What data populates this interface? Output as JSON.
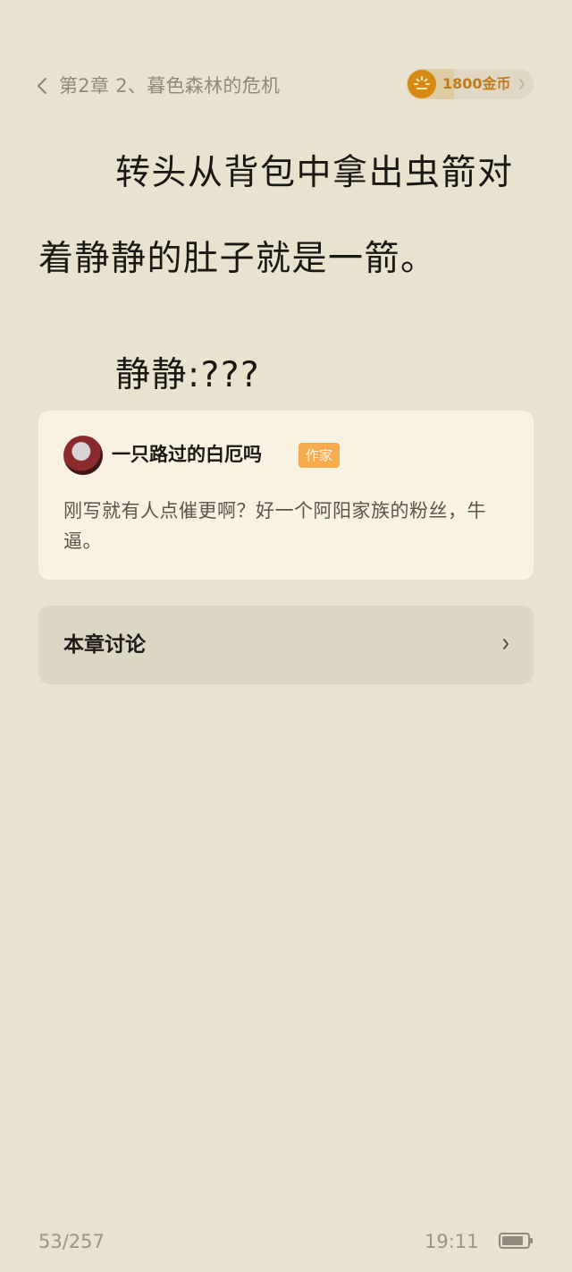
{
  "header": {
    "back_icon": "chevron-left-icon",
    "chapter_title": "第2章  2、暮色森林的危机",
    "coins": {
      "icon": "coin-timer-icon",
      "label": "1800金币",
      "progress_fraction": 0.37,
      "accent_color": "#d88b12"
    }
  },
  "content": {
    "paragraphs": [
      "转头从背包中拿出虫箭对着静静的肚子就是一箭。",
      "静静:???"
    ]
  },
  "author_comment": {
    "avatar_icon": "author-avatar",
    "author_name": "一只路过的白厄吗",
    "badge": "作家",
    "text": "刚写就有人点催更啊？好一个阿阳家族的粉丝，牛逼。"
  },
  "discussion": {
    "label": "本章讨论",
    "chevron_icon": "chevron-right-icon"
  },
  "footer": {
    "page": "53/257",
    "time": "19:11",
    "battery_icon": "battery-icon",
    "battery_level": 0.85
  }
}
